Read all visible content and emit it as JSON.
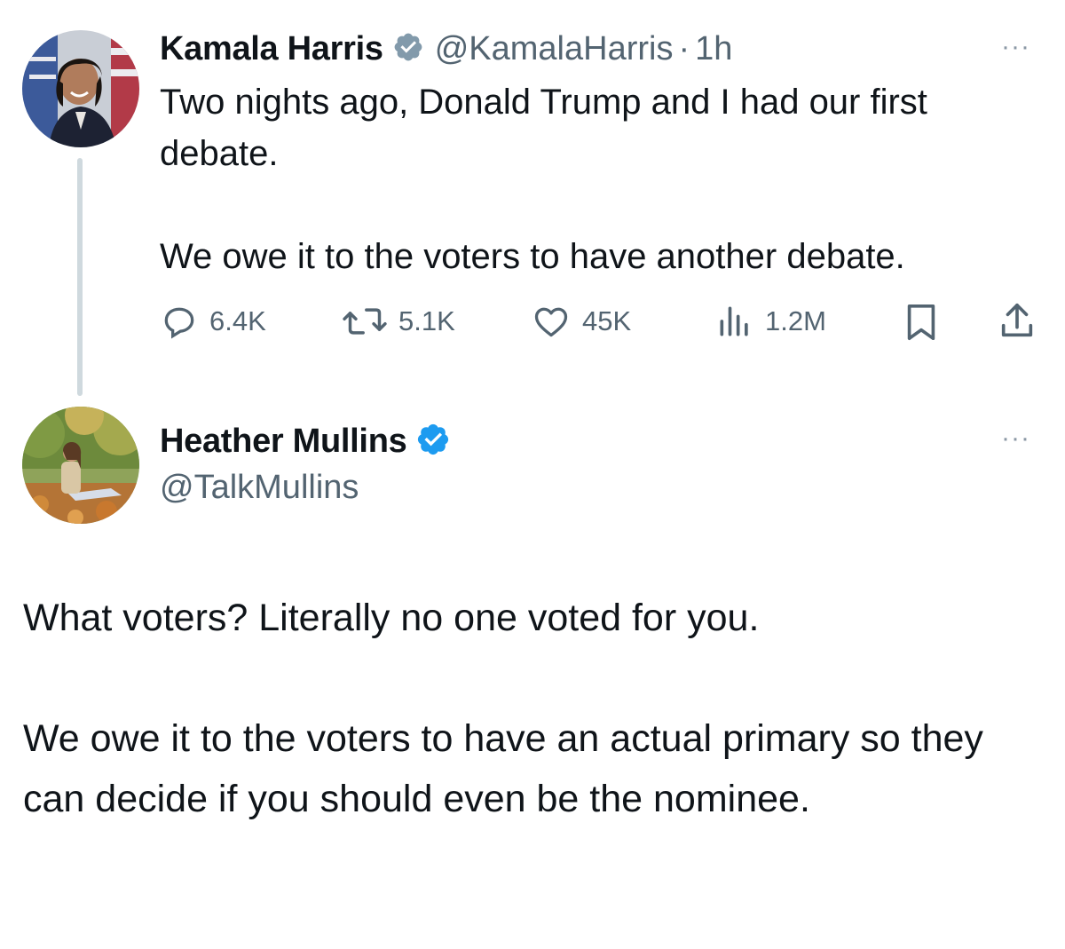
{
  "tweet": {
    "author_name": "Kamala Harris",
    "author_handle": "@KamalaHarris",
    "separator": "·",
    "time": "1h",
    "badge": "verified-gray-badge-icon",
    "more_icon": "more-horizontal-icon",
    "more_label": "···",
    "text": "Two nights ago, Donald Trump and I had our first debate.\n\nWe owe it to the voters to have another debate.",
    "actions": {
      "replies": "6.4K",
      "reposts": "5.1K",
      "likes": "45K",
      "views": "1.2M"
    }
  },
  "reply": {
    "author_name": "Heather Mullins",
    "author_handle": "@TalkMullins",
    "badge": "verified-blue-badge-icon",
    "more_icon": "more-horizontal-icon",
    "more_label": "···",
    "text": "What voters? Literally no one voted for you.\n\nWe owe it to the voters to have an actual primary so they can decide if you should even be the nominee."
  },
  "colors": {
    "text": "#0f1419",
    "secondary": "#536471",
    "verified_blue": "#1d9bf0",
    "verified_gray": "#829aab",
    "thread_line": "#cfd9de"
  }
}
